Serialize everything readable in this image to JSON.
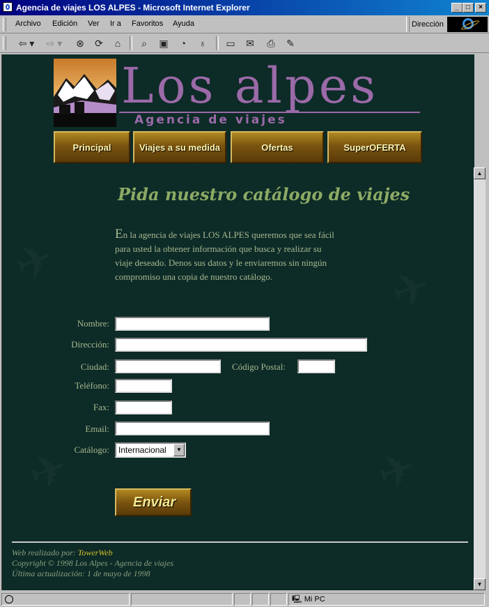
{
  "window": {
    "title": "Agencia de viajes LOS ALPES - Microsoft Internet Explorer",
    "controls": {
      "minimize": "_",
      "maximize": "□",
      "close": "×"
    }
  },
  "menu": {
    "items": [
      "Archivo",
      "Edición",
      "Ver",
      "Ir a",
      "Favoritos",
      "Ayuda"
    ],
    "address_label": "Dirección"
  },
  "toolbar": {
    "buttons": [
      "back-icon",
      "forward-icon",
      "stop-icon",
      "refresh-icon",
      "home-icon",
      "search-icon",
      "favorites-icon",
      "history-icon",
      "channels-icon",
      "fullscreen-icon",
      "mail-icon",
      "print-icon",
      "edit-icon"
    ]
  },
  "site": {
    "logo_title": "Los alpes",
    "logo_subtitle": "Agencia de viajes",
    "nav": [
      "Principal",
      "Viajes a su medida",
      "Ofertas",
      "SuperOFERTA"
    ],
    "heading": "Pida nuestro catálogo de viajes",
    "intro_initial": "E",
    "intro_text": "n la agencia de viajes LOS ALPES queremos que sea fácil para usted la obtener información que busca y realizar su viaje deseado. Denos sus datos y le enviaremos sin ningún compromiso una copia de nuestro catálogo."
  },
  "form": {
    "nombre_label": "Nombre:",
    "direccion_label": "Dirección:",
    "ciudad_label": "Ciudad:",
    "codigo_postal_label": "Código Postal:",
    "telefono_label": "Teléfono:",
    "fax_label": "Fax:",
    "email_label": "Email:",
    "catalogo_label": "Catálogo:",
    "catalogo_selected": "Internacional",
    "submit_label": "Enviar"
  },
  "footer": {
    "made_by_prefix": "Web realizado por:",
    "made_by_link": "TowerWeb",
    "copyright": "Copyright © 1998 Los Alpes - Agencia de viajes",
    "updated": "Última actualización: 1 de mayo de 1998"
  },
  "statusbar": {
    "zone": "Mi PC"
  }
}
